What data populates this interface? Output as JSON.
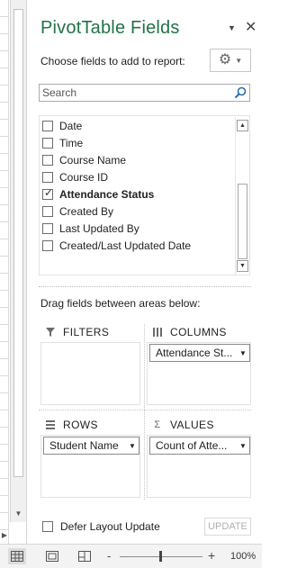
{
  "pane": {
    "title": "PivotTable Fields",
    "choose_label": "Choose fields to add to report:",
    "search_placeholder": "Search"
  },
  "fields": [
    {
      "label": "Date",
      "checked": false
    },
    {
      "label": "Time",
      "checked": false
    },
    {
      "label": "Course Name",
      "checked": false
    },
    {
      "label": "Course ID",
      "checked": false
    },
    {
      "label": "Attendance Status",
      "checked": true
    },
    {
      "label": "Created By",
      "checked": false
    },
    {
      "label": "Last Updated By",
      "checked": false
    },
    {
      "label": "Created/Last Updated Date",
      "checked": false
    }
  ],
  "areas": {
    "drag_label": "Drag fields between areas below:",
    "filters": {
      "title": "FILTERS",
      "items": []
    },
    "columns": {
      "title": "COLUMNS",
      "items": [
        "Attendance St..."
      ]
    },
    "rows": {
      "title": "ROWS",
      "items": [
        "Student Name"
      ]
    },
    "values": {
      "title": "VALUES",
      "items": [
        "Count of Atte..."
      ]
    }
  },
  "footer": {
    "defer_label": "Defer Layout Update",
    "update_label": "UPDATE"
  },
  "statusbar": {
    "zoom_minus": "-",
    "zoom_plus": "+",
    "zoom_level": "100%"
  },
  "colors": {
    "accent": "#217346",
    "pane_bg": "#ffffff",
    "statusbar_bg": "#f3f3f3"
  },
  "icons": {
    "settings": "gear-icon",
    "search": "search-icon",
    "filters": "filter-icon",
    "columns": "columns-icon",
    "rows": "rows-icon",
    "values": "sigma-icon"
  }
}
